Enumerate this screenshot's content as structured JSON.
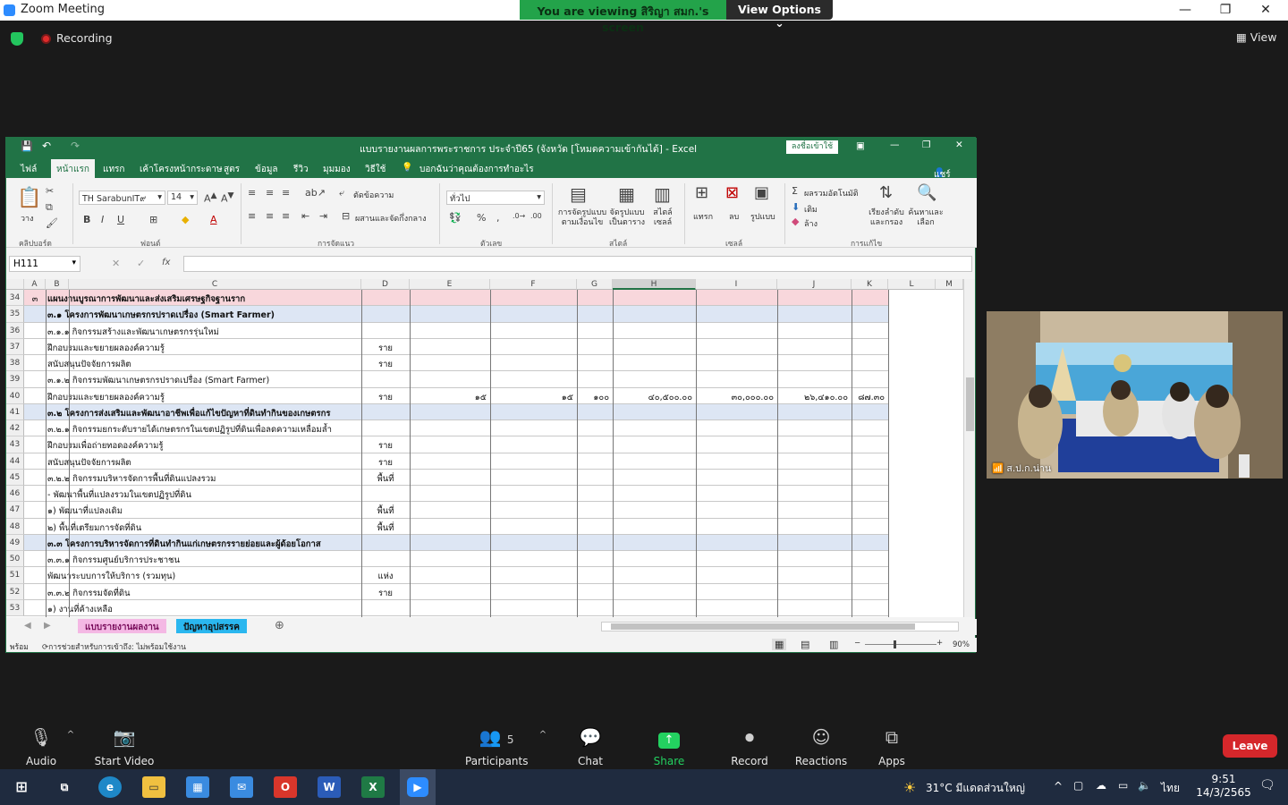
{
  "zoom": {
    "title": "Zoom Meeting",
    "viewing_banner": "You are viewing สิริญา สมก.'s screen",
    "view_options": "View Options ⌄",
    "recording": "Recording",
    "view_label": "View",
    "participant_name": "ส.ป.ก.น่าน",
    "controls": {
      "audio": "Audio",
      "start_video": "Start Video",
      "participants": "Participants",
      "participants_count": "5",
      "chat": "Chat",
      "share_screen": "Share Screen",
      "record": "Record",
      "reactions": "Reactions",
      "apps": "Apps",
      "leave": "Leave"
    }
  },
  "excel": {
    "title": "แบบรายงานผลการพระราชการ ประจำปี65 (จังหวัด [โหมดความเข้ากันได้] - Excel",
    "signin": "ลงชื่อเข้าใช้",
    "tabs": [
      "ไฟล์",
      "หน้าแรก",
      "แทรก",
      "เค้าโครงหน้ากระดาษ",
      "สูตร",
      "ข้อมูล",
      "รีวิว",
      "มุมมอง",
      "วิธีใช้",
      "บอกฉันว่าคุณต้องการทำอะไร"
    ],
    "share": "แชร์",
    "ribbon": {
      "font_name": "TH SarabunIT๙",
      "font_size": "14",
      "number_format": "ทั่วไป",
      "wrap_text": "ตัดข้อความ",
      "merge_center": "ผสานและจัดกึ่งกลาง",
      "autosum": "ผลรวมอัตโนมัติ",
      "fill": "เติม",
      "clear": "ล้าง",
      "cond_format": "การจัดรูปแบบตามเงื่อนไข",
      "format_table": "จัดรูปแบบเป็นตาราง",
      "cell_styles": "สไตล์เซลล์",
      "insert": "แทรก",
      "delete": "ลบ",
      "format": "รูปแบบ",
      "sort_filter": "เรียงลำดับและกรอง",
      "find_select": "ค้นหาและเลือก",
      "paste": "วาง",
      "groups": [
        "คลิปบอร์ด",
        "ฟอนต์",
        "การจัดแนว",
        "ตัวเลข",
        "สไตล์",
        "เซลล์",
        "การแก้ไข"
      ]
    },
    "name_box": "H111",
    "fx": "fx",
    "columns": [
      "A",
      "B",
      "C",
      "D",
      "E",
      "F",
      "G",
      "H",
      "I",
      "J",
      "K",
      "L",
      "M"
    ],
    "rows": [
      {
        "n": "34",
        "a": "๓",
        "c": "แผนงานบูรณาการพัฒนาและส่งเสริมเศรษฐกิจฐานราก",
        "d": "",
        "e": "",
        "f": "",
        "g": "",
        "h": "",
        "i": "",
        "j": "",
        "k": ""
      },
      {
        "n": "35",
        "a": "",
        "c": "๓.๑  โครงการพัฒนาเกษตรกรปราดเปรื่อง (Smart Farmer)",
        "d": "",
        "e": "",
        "f": "",
        "g": "",
        "h": "",
        "i": "",
        "j": "",
        "k": ""
      },
      {
        "n": "36",
        "a": "",
        "c": "        ๓.๑.๑  กิจกรรมสร้างและพัฒนาเกษตรกรรุ่นใหม่",
        "d": "",
        "e": "",
        "f": "",
        "g": "",
        "h": "",
        "i": "",
        "j": "",
        "k": ""
      },
      {
        "n": "37",
        "a": "",
        "c": "                  ฝึกอบรมและขยายผลองค์ความรู้",
        "d": "ราย",
        "e": "",
        "f": "",
        "g": "",
        "h": "",
        "i": "",
        "j": "",
        "k": ""
      },
      {
        "n": "38",
        "a": "",
        "c": "                  สนับสนุนปัจจัยการผลิต",
        "d": "ราย",
        "e": "",
        "f": "",
        "g": "",
        "h": "",
        "i": "",
        "j": "",
        "k": ""
      },
      {
        "n": "39",
        "a": "",
        "c": "        ๓.๑.๒ กิจกรรมพัฒนาเกษตรกรปราดเปรื่อง (Smart Farmer)",
        "d": "",
        "e": "",
        "f": "",
        "g": "",
        "h": "",
        "i": "",
        "j": "",
        "k": ""
      },
      {
        "n": "40",
        "a": "",
        "c": "                  ฝึกอบรมและขยายผลองค์ความรู้",
        "d": "ราย",
        "e": "๑๕",
        "f": "๑๕",
        "g": "๑๐๐",
        "h": "๔๐,๕๐๐.๐๐",
        "i": "๓๐,๐๐๐.๐๐",
        "j": "๒๖,๔๑๐.๐๐",
        "k": "๘๗.๓๐"
      },
      {
        "n": "41",
        "a": "",
        "c": "๓.๒  โครงการส่งเสริมและพัฒนาอาชีพเพื่อแก้ไขปัญหาที่ดินทำกินของเกษตรกร",
        "d": "",
        "e": "",
        "f": "",
        "g": "",
        "h": "",
        "i": "",
        "j": "",
        "k": ""
      },
      {
        "n": "42",
        "a": "",
        "c": "        ๓.๒.๑  กิจกรรมยกระดับรายได้เกษตรกรในเขตปฏิรูปที่ดินเพื่อลดความเหลื่อมล้ำ",
        "d": "",
        "e": "",
        "f": "",
        "g": "",
        "h": "",
        "i": "",
        "j": "",
        "k": ""
      },
      {
        "n": "43",
        "a": "",
        "c": "                ฝึกอบรมเพื่อถ่ายทอดองค์ความรู้",
        "d": "ราย",
        "e": "",
        "f": "",
        "g": "",
        "h": "",
        "i": "",
        "j": "",
        "k": ""
      },
      {
        "n": "44",
        "a": "",
        "c": "                สนับสนุนปัจจัยการผลิต",
        "d": "ราย",
        "e": "",
        "f": "",
        "g": "",
        "h": "",
        "i": "",
        "j": "",
        "k": ""
      },
      {
        "n": "45",
        "a": "",
        "c": "        ๓.๒.๒  กิจกรรมบริหารจัดการพื้นที่ดินแปลงรวม",
        "d": "พื้นที่",
        "e": "",
        "f": "",
        "g": "",
        "h": "",
        "i": "",
        "j": "",
        "k": ""
      },
      {
        "n": "46",
        "a": "",
        "c": "        - พัฒนาพื้นที่แปลงรวมในเขตปฏิรูปที่ดิน",
        "d": "",
        "e": "",
        "f": "",
        "g": "",
        "h": "",
        "i": "",
        "j": "",
        "k": ""
      },
      {
        "n": "47",
        "a": "",
        "c": "              ๑) พัฒนาที่แปลงเดิม",
        "d": "พื้นที่",
        "e": "",
        "f": "",
        "g": "",
        "h": "",
        "i": "",
        "j": "",
        "k": ""
      },
      {
        "n": "48",
        "a": "",
        "c": "              ๒) พื้นที่เตรียมการจัดที่ดิน",
        "d": "พื้นที่",
        "e": "",
        "f": "",
        "g": "",
        "h": "",
        "i": "",
        "j": "",
        "k": ""
      },
      {
        "n": "49",
        "a": "",
        "c": "๓.๓  โครงการบริหารจัดการที่ดินทำกินแก่เกษตรกรรายย่อยและผู้ด้อยโอกาส",
        "d": "",
        "e": "",
        "f": "",
        "g": "",
        "h": "",
        "i": "",
        "j": "",
        "k": ""
      },
      {
        "n": "50",
        "a": "",
        "c": "        ๓.๓.๑  กิจกรรมศูนย์บริการประชาชน",
        "d": "",
        "e": "",
        "f": "",
        "g": "",
        "h": "",
        "i": "",
        "j": "",
        "k": ""
      },
      {
        "n": "51",
        "a": "",
        "c": "                พัฒนาระบบการให้บริการ (รวมทุน)",
        "d": "แห่ง",
        "e": "",
        "f": "",
        "g": "",
        "h": "",
        "i": "",
        "j": "",
        "k": ""
      },
      {
        "n": "52",
        "a": "",
        "c": "        ๓.๓.๒  กิจกรรมจัดที่ดิน",
        "d": "ราย",
        "e": "",
        "f": "",
        "g": "",
        "h": "",
        "i": "",
        "j": "",
        "k": ""
      },
      {
        "n": "53",
        "a": "",
        "c": "              ๑) งานที่ค้างเหลือ",
        "d": "",
        "e": "",
        "f": "",
        "g": "",
        "h": "",
        "i": "",
        "j": "",
        "k": ""
      }
    ],
    "sheet_tabs": [
      "แบบรายงานผลงาน",
      "ปัญหาอุปสรรค"
    ],
    "status_ready": "พร้อม",
    "status_accessibility": "การช่วยสำหรับการเข้าถึง: ไม่พร้อมใช้งาน",
    "zoom_level": "90%"
  },
  "taskbar": {
    "weather": "31°C  มีแดดส่วนใหญ่",
    "lang": "ไทย",
    "time": "9:51",
    "date": "14/3/2565"
  },
  "colors": {
    "excel_green": "#217346",
    "section_pink": "#f8d7dc",
    "section_blue": "#dde6f4",
    "leave_red": "#d5272b",
    "share_green": "#23d160"
  }
}
